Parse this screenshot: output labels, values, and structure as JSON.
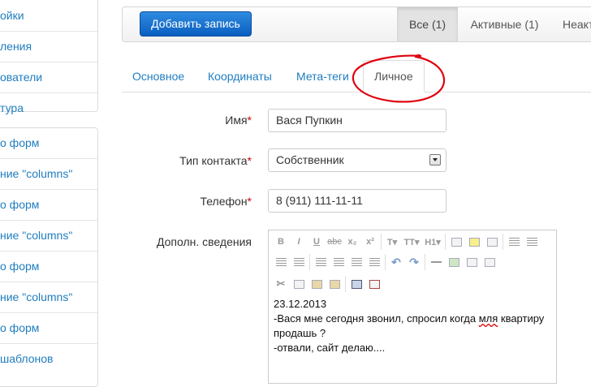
{
  "sidebar": {
    "group1": [
      "ойки",
      "ления",
      "ователи",
      "тура"
    ],
    "group2": [
      "о форм",
      "ние \"columns\"",
      "о форм",
      "ние \"columns\"",
      "о форм",
      "ние \"columns\"",
      "о форм",
      "шаблонов"
    ]
  },
  "toolbar": {
    "add_label": "Добавить запись",
    "filter_all": "Все (1)",
    "filter_active": "Активные (1)",
    "filter_inactive": "Неакт"
  },
  "tabs": {
    "main": "Основное",
    "coords": "Координаты",
    "meta": "Мета-теги",
    "personal": "Личное"
  },
  "form": {
    "name_label": "Имя",
    "name_value": "Вася Пупкин",
    "contact_type_label": "Тип контакта",
    "contact_type_value": "Собственник",
    "phone_label": "Телефон",
    "phone_value": "8 (911) 111-11-11",
    "extra_label": "Дополн. сведения",
    "required_mark": "*"
  },
  "editor": {
    "line1": "23.12.2013",
    "line2_pre": "-Вася мне сегодня звонил, спросил когда ",
    "line2_spell": "мля",
    "line2_post": " квартиру",
    "line3": "продашь ?",
    "line4": "-отвали, сайт делаю....",
    "toolbar_row1": [
      "B",
      "I",
      "U",
      "abc",
      "x₂",
      "x²",
      "T▾",
      "TT▾",
      "H1▾"
    ]
  },
  "colors": {
    "link": "#1f7dbf",
    "primary_button": "#0a5fc0",
    "required": "#cc0000",
    "annotation": "#e0000f"
  }
}
